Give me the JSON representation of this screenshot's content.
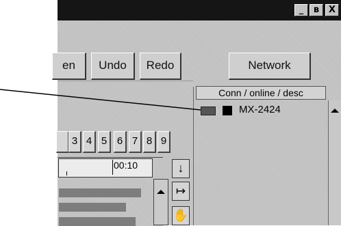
{
  "window": {
    "buttons": [
      "_",
      "ʙ",
      "X"
    ]
  },
  "toolbar": {
    "open_label": "en",
    "undo_label": "Undo",
    "redo_label": "Redo",
    "network_label": "Network"
  },
  "device_panel": {
    "header": "Conn / online / desc",
    "devices": [
      {
        "name": "MX-2424"
      }
    ]
  },
  "track_numbers": [
    "3",
    "4",
    "5",
    "6",
    "7",
    "8",
    "9"
  ],
  "timeline": {
    "timecode": "00:10"
  },
  "tools": {
    "down_arrow": "↓",
    "fit_width": "↦",
    "hand_tool": "✋"
  }
}
